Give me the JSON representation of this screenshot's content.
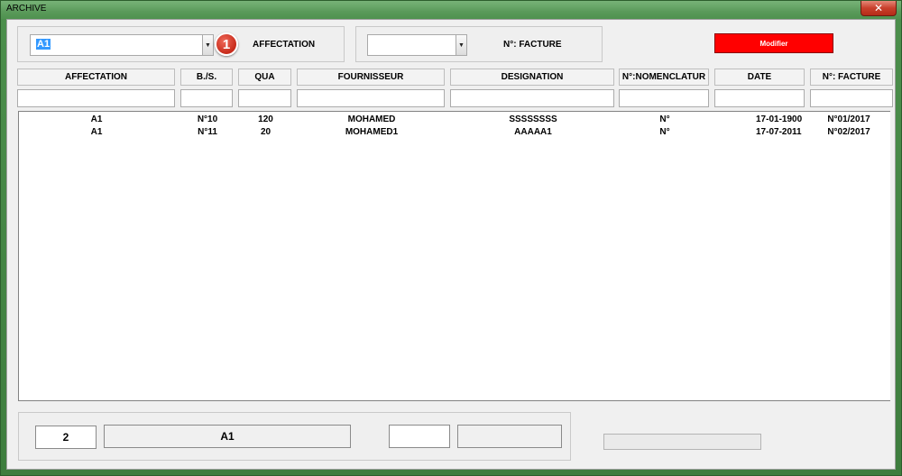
{
  "window": {
    "title": "ARCHIVE",
    "close_label": "✕"
  },
  "top": {
    "affectation_combo_value": "A1",
    "badge_number": "1",
    "affectation_label": "AFFECTATION",
    "facture_combo_value": "",
    "facture_label": "N°: FACTURE",
    "modify_button_label": "Modifier"
  },
  "table": {
    "columns": [
      "AFFECTATION",
      "B./S.",
      "QUA",
      "FOURNISSEUR",
      "DESIGNATION",
      "N°:NOMENCLATUR",
      "DATE",
      "N°: FACTURE"
    ],
    "rows": [
      [
        "A1",
        "N°10",
        "120",
        "MOHAMED",
        "SSSSSSSS",
        "N°",
        "17-01-1900",
        "N°01/2017"
      ],
      [
        "A1",
        "N°11",
        "20",
        "MOHAMED1",
        "AAAAA1",
        "N°",
        "17-07-2011",
        "N°02/2017"
      ]
    ]
  },
  "bottom": {
    "count_value": "2",
    "affectation_value": "A1",
    "box3_value": "",
    "box4_value": ""
  },
  "colors": {
    "accent_red": "#ff0000",
    "window_green": "#4c8f4c"
  }
}
